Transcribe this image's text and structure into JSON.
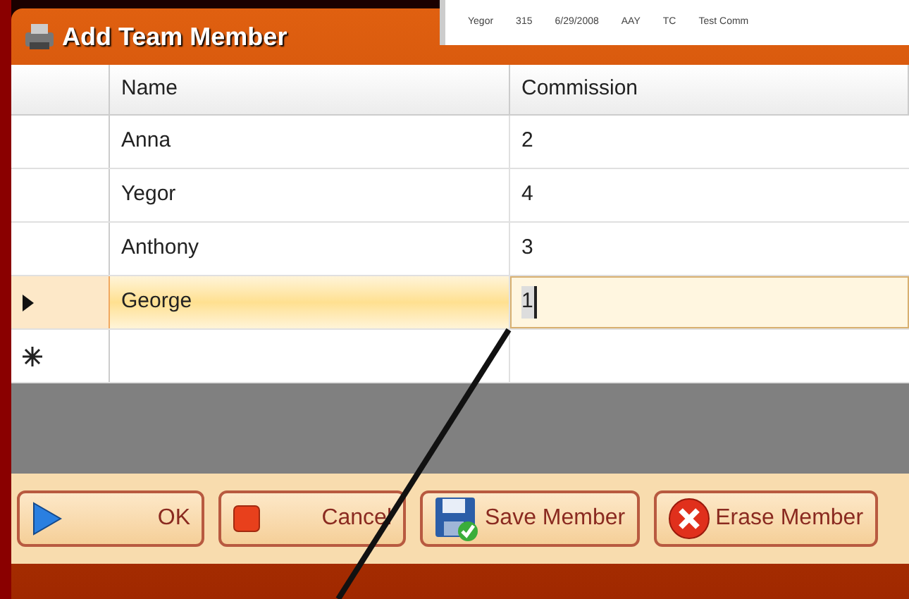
{
  "background_window": {
    "row": [
      "Yegor",
      "315",
      "6/29/2008",
      "AAY",
      "TC",
      "Test Comm"
    ]
  },
  "window": {
    "title": "Add Team Member"
  },
  "table": {
    "columns": [
      "Name",
      "Commission"
    ],
    "rows": [
      {
        "kind": "data",
        "name": "Anna",
        "commission": "2",
        "selected": false,
        "editing": false
      },
      {
        "kind": "data",
        "name": "Yegor",
        "commission": "4",
        "selected": false,
        "editing": false
      },
      {
        "kind": "data",
        "name": "Anthony",
        "commission": "3",
        "selected": false,
        "editing": false
      },
      {
        "kind": "data",
        "name": "George",
        "commission": "1",
        "selected": true,
        "editing": true
      },
      {
        "kind": "new",
        "selected": false,
        "editing": false
      }
    ]
  },
  "buttons": [
    {
      "label": "OK"
    },
    {
      "label": "Cancel"
    },
    {
      "label": "Save Member"
    },
    {
      "label": "Erase Member"
    }
  ]
}
